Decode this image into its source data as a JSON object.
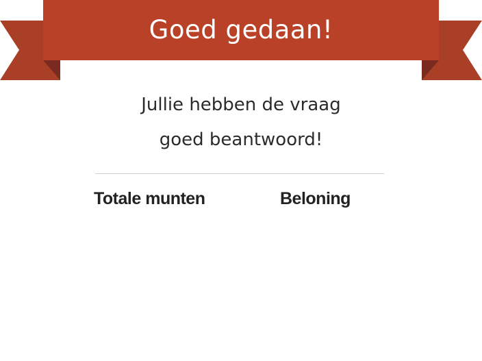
{
  "dialog": {
    "title": "Goed gedaan!",
    "message_line1": "Jullie hebben de vraag",
    "message_line2": "goed beantwoord!",
    "total_coins_label": "Totale munten",
    "reward_label": "Beloning"
  },
  "colors": {
    "ribbon": "#b94127",
    "ribbon_tail": "#a93f26",
    "ribbon_fold": "#7a2a1f",
    "text": "#2b2b2b",
    "divider": "#cfcfcf",
    "background": "#ffffff"
  }
}
